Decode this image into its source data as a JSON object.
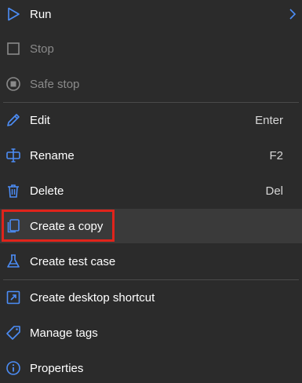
{
  "menu": {
    "items": [
      {
        "label": "Run",
        "shortcut": "",
        "icon": "play-icon",
        "disabled": false
      },
      {
        "label": "Stop",
        "shortcut": "",
        "icon": "stop-square-icon",
        "disabled": true
      },
      {
        "label": "Safe stop",
        "shortcut": "",
        "icon": "safe-stop-icon",
        "disabled": true
      },
      {
        "label": "Edit",
        "shortcut": "Enter",
        "icon": "pencil-icon",
        "disabled": false
      },
      {
        "label": "Rename",
        "shortcut": "F2",
        "icon": "rename-icon",
        "disabled": false
      },
      {
        "label": "Delete",
        "shortcut": "Del",
        "icon": "trash-icon",
        "disabled": false
      },
      {
        "label": "Create a copy",
        "shortcut": "",
        "icon": "copy-icon",
        "disabled": false
      },
      {
        "label": "Create test case",
        "shortcut": "",
        "icon": "flask-icon",
        "disabled": false
      },
      {
        "label": "Create desktop shortcut",
        "shortcut": "",
        "icon": "shortcut-icon",
        "disabled": false
      },
      {
        "label": "Manage tags",
        "shortcut": "",
        "icon": "tag-icon",
        "disabled": false
      },
      {
        "label": "Properties",
        "shortcut": "",
        "icon": "info-icon",
        "disabled": false
      }
    ]
  },
  "colors": {
    "accent": "#4c8df6",
    "background": "#2b2b2b",
    "hover": "#3a3a3a",
    "highlight": "#e0241b",
    "disabled": "#8a8a8a"
  }
}
